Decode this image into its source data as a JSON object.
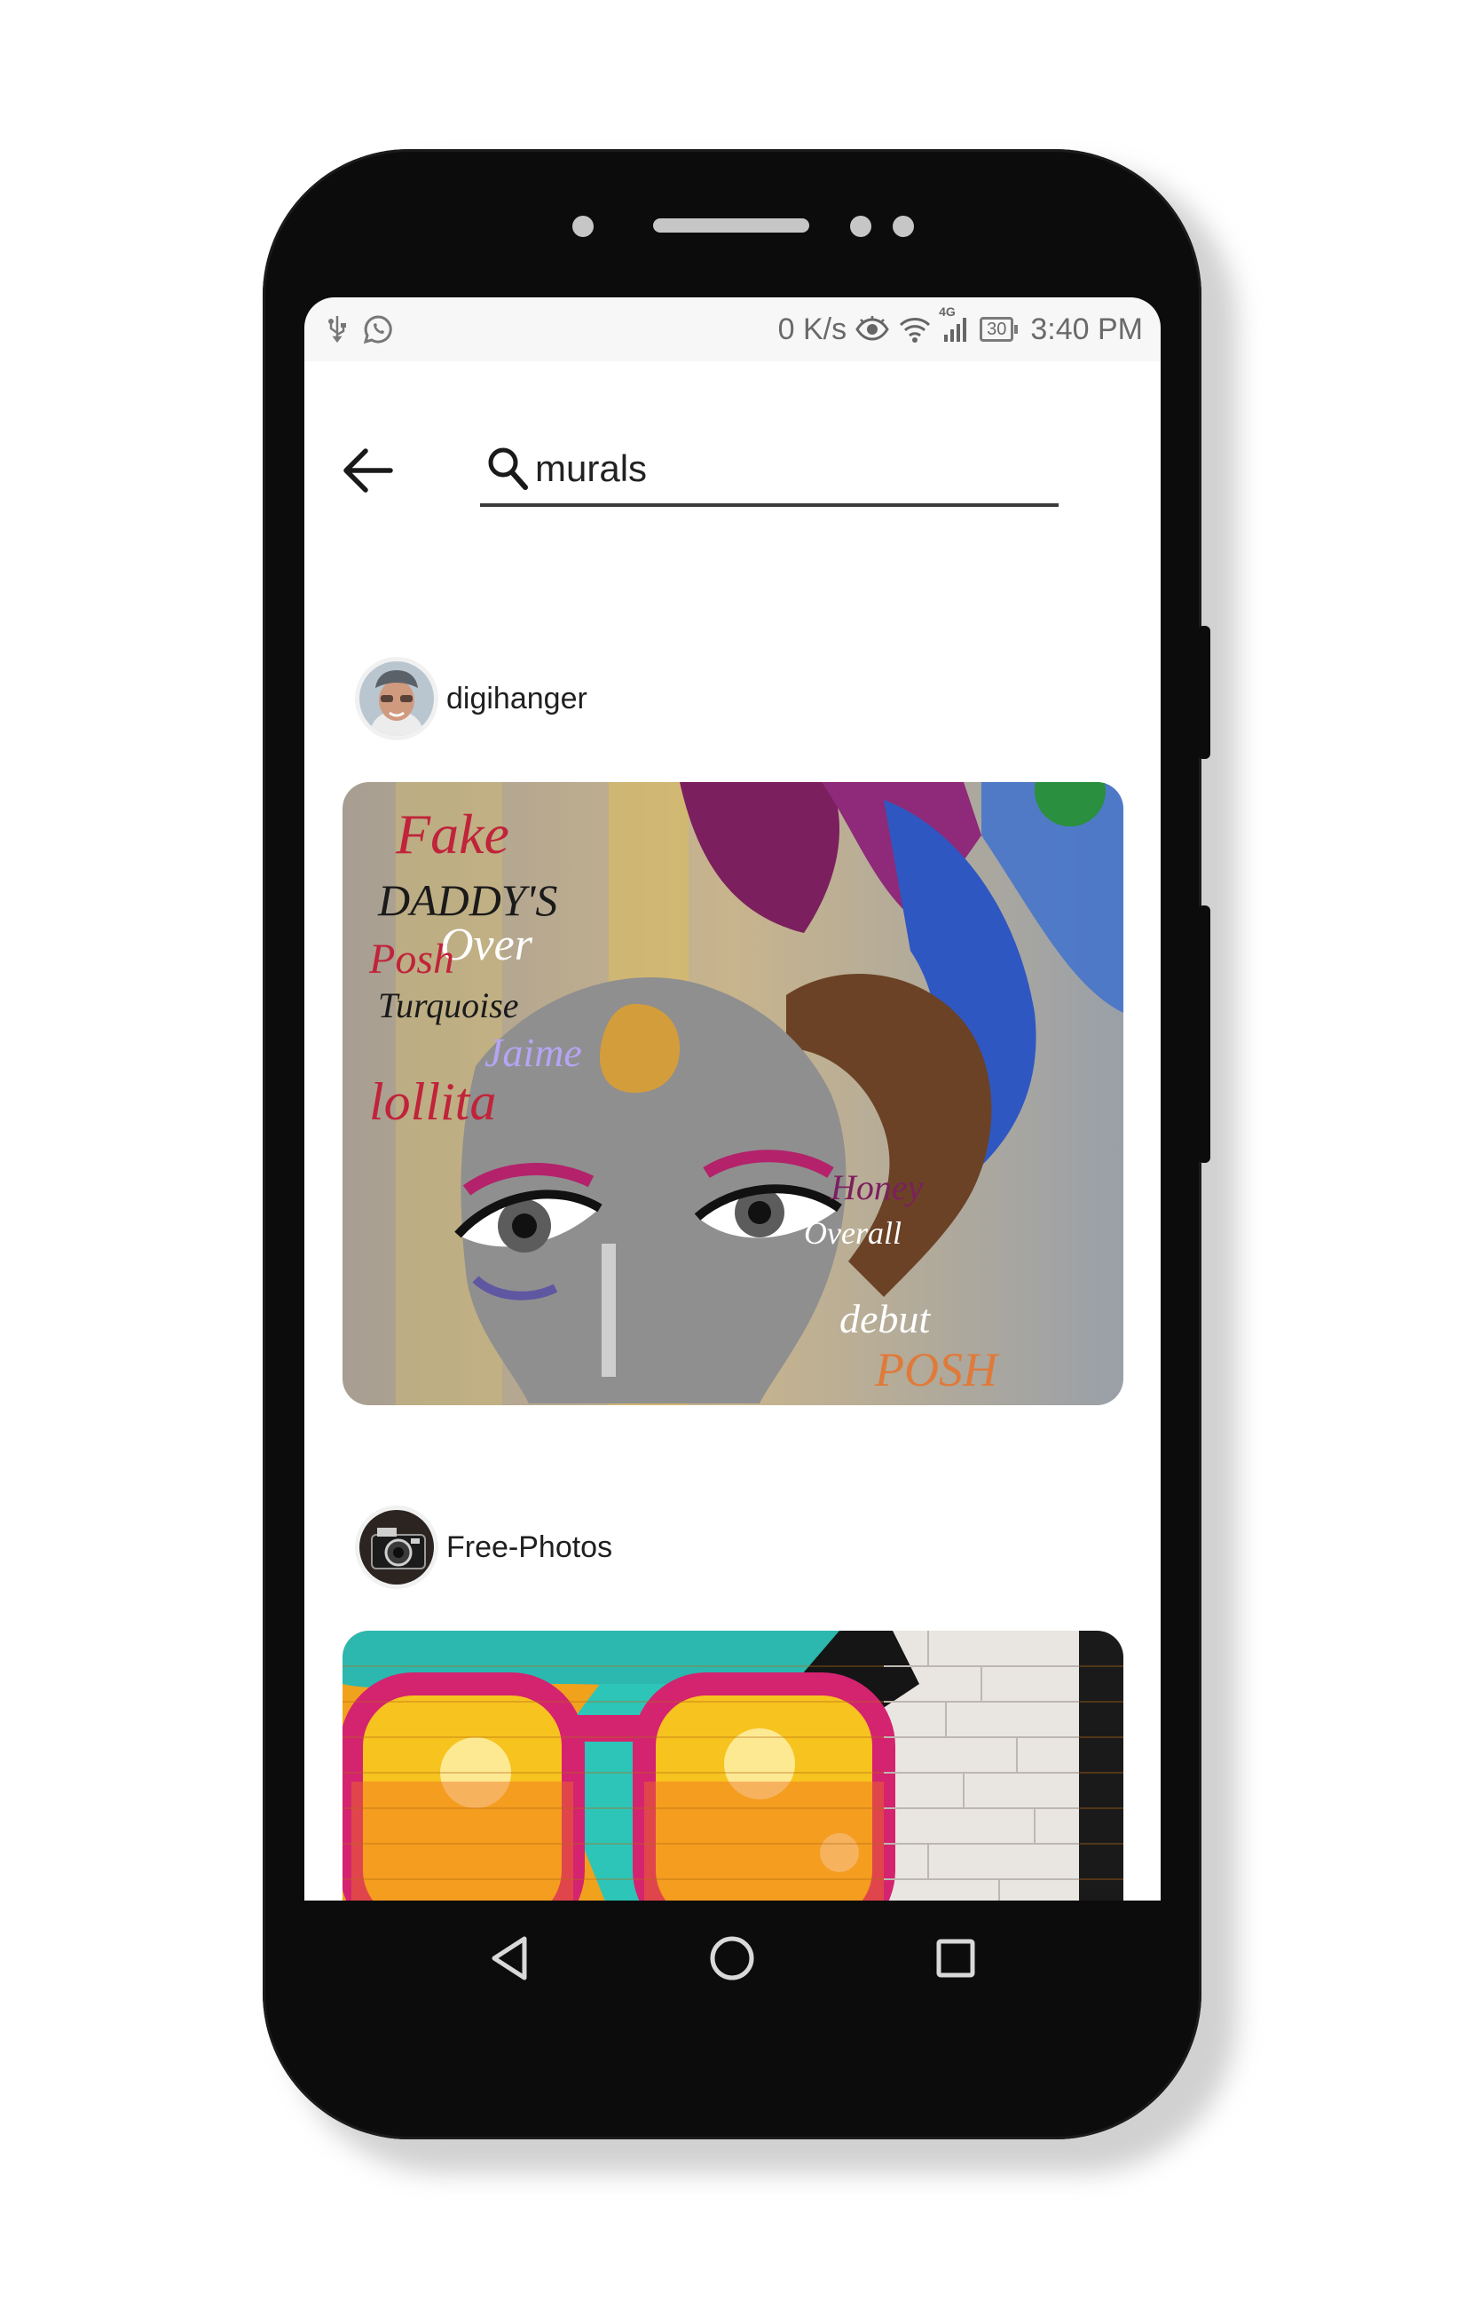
{
  "status_bar": {
    "net_speed": "0 K/s",
    "signal_badge": "4G",
    "battery_level": "30",
    "time": "3:40 PM",
    "icons": [
      "usb-icon",
      "whatsapp-icon",
      "eye-icon",
      "wifi-icon",
      "signal-icon",
      "battery-icon"
    ]
  },
  "search": {
    "value": "murals",
    "icon": "search-icon",
    "back_icon": "back-arrow-icon"
  },
  "posts": [
    {
      "username": "digihanger",
      "avatar_icon": "user-avatar",
      "image": "graffiti-face-mural"
    },
    {
      "username": "Free-Photos",
      "avatar_icon": "camera-avatar",
      "image": "graffiti-sunglasses-mural"
    }
  ],
  "nav": {
    "back_icon": "triangle-back-icon",
    "home_icon": "circle-home-icon",
    "recents_icon": "square-recents-icon"
  },
  "colors": {
    "phone_body": "#0c0c0c",
    "screen_bg": "#ffffff",
    "status_text": "#6a6a6a",
    "search_underline": "#3b3b3b"
  }
}
